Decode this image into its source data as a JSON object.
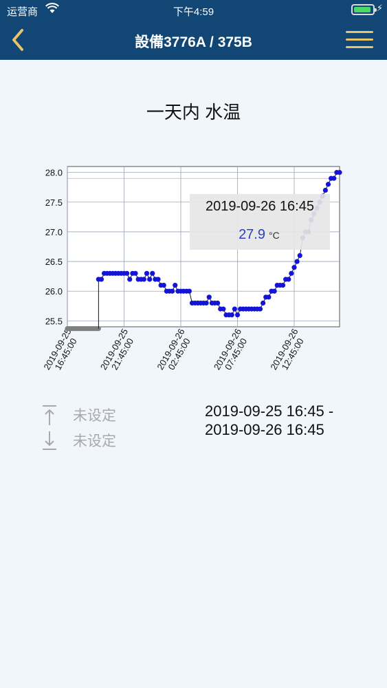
{
  "status_bar": {
    "carrier": "运营商",
    "time": "下午4:59"
  },
  "nav": {
    "title": "設備3776A / 375B"
  },
  "chart_title": "一天内  水温",
  "limits": {
    "upper_label": "未设定",
    "lower_label": "未设定"
  },
  "range": {
    "start": "2019-09-25 16:45 -",
    "end": "2019-09-26 16:45"
  },
  "tooltip": {
    "datetime": "2019-09-26 16:45",
    "value": "27.9",
    "unit": "°C"
  },
  "colors": {
    "nav_bg": "#114675",
    "accent": "#e8c46a",
    "series": "#1414d6",
    "missing": "#7f7f7f",
    "tooltip_value": "#2a3fc0"
  },
  "chart_data": {
    "type": "scatter",
    "title": "",
    "xlabel": "",
    "ylabel": "",
    "x_ticks": [
      "2019-09-25 16:45:00",
      "2019-09-25 21:45:00",
      "2019-09-26 02:45:00",
      "2019-09-26 07:45:00",
      "2019-09-26 12:45:00"
    ],
    "y_ticks": [
      "25.5",
      "26.0",
      "26.5",
      "27.0",
      "27.5",
      "28.0"
    ],
    "ylim": [
      25.4,
      28.1
    ],
    "x_range_hours": [
      0,
      24
    ],
    "grid": true,
    "reference_line": 27.9,
    "missing_segment": {
      "x_hours": [
        0,
        2.75
      ],
      "value": 25.37
    },
    "series": [
      {
        "x_hours": [
          2.75,
          3.0,
          3.25,
          3.5,
          3.75,
          4.0,
          4.25,
          4.5,
          4.75,
          5.0,
          5.25,
          5.5,
          5.75,
          6.0,
          6.25,
          6.5,
          6.75,
          7.0,
          7.25,
          7.5,
          7.75,
          8.0,
          8.25,
          8.5,
          8.75,
          9.0,
          9.25,
          9.5,
          9.75,
          10.0,
          10.25,
          10.5,
          10.75,
          11.0,
          11.25,
          11.5,
          11.75,
          12.0,
          12.25,
          12.5,
          12.75,
          13.0,
          13.25,
          13.5,
          13.75,
          14.0,
          14.25,
          14.5,
          14.75,
          15.0,
          15.25,
          15.5,
          15.75,
          16.0,
          16.25,
          16.5,
          16.75,
          17.0,
          17.25,
          17.5,
          17.75,
          18.0,
          18.25,
          18.5,
          18.75,
          19.0,
          19.25,
          19.5,
          19.75,
          20.0,
          20.25,
          20.5,
          20.75,
          21.0,
          21.25,
          21.5,
          21.75,
          22.0,
          22.25,
          22.5,
          22.75,
          23.0,
          23.25,
          23.5,
          23.75,
          24.0
        ],
        "values": [
          26.2,
          26.2,
          26.3,
          26.3,
          26.3,
          26.3,
          26.3,
          26.3,
          26.3,
          26.3,
          26.3,
          26.2,
          26.3,
          26.3,
          26.2,
          26.2,
          26.2,
          26.3,
          26.2,
          26.3,
          26.2,
          26.2,
          26.1,
          26.1,
          26.0,
          26.0,
          26.0,
          26.1,
          26.0,
          26.0,
          26.0,
          26.0,
          26.0,
          25.8,
          25.8,
          25.8,
          25.8,
          25.8,
          25.8,
          25.9,
          25.8,
          25.8,
          25.8,
          25.7,
          25.7,
          25.6,
          25.6,
          25.6,
          25.7,
          25.6,
          25.7,
          25.7,
          25.7,
          25.7,
          25.7,
          25.7,
          25.7,
          25.7,
          25.8,
          25.9,
          25.9,
          26.0,
          26.0,
          26.1,
          26.1,
          26.1,
          26.2,
          26.2,
          26.3,
          26.4,
          26.5,
          26.6,
          26.9,
          27.0,
          27.0,
          27.2,
          27.3,
          27.4,
          27.5,
          27.6,
          27.7,
          27.8,
          27.9,
          27.9,
          28.0,
          28.0,
          27.9
        ]
      }
    ]
  }
}
